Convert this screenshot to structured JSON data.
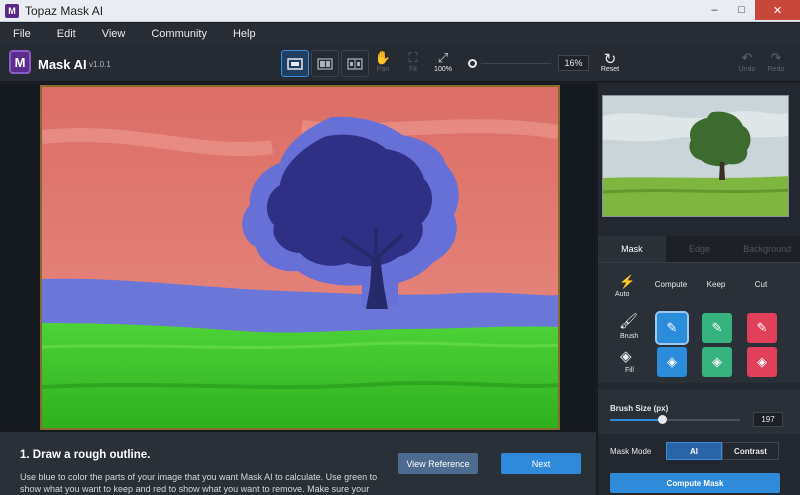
{
  "window": {
    "title": "Topaz Mask AI",
    "controls": [
      "–",
      "□",
      "✕"
    ]
  },
  "menu": [
    "File",
    "Edit",
    "View",
    "Community",
    "Help"
  ],
  "toolbar": {
    "logo_letter": "M",
    "app_name": "Mask AI",
    "version": "v1.0.1",
    "tools": {
      "pan": "Pan",
      "fit": "Fit",
      "zoom100": "100%",
      "reset": "Reset",
      "undo": "Undo",
      "redo": "Redo"
    },
    "zoom_value": "16%"
  },
  "instructions": {
    "title": "1. Draw a rough outline.",
    "text": "Use blue to color the parts of your image that you want Mask AI to calculate. Use green to show what you want to keep and red to show what you want to remove. Make sure your red/greens are accurate (feel free to apply a lot of blue)!",
    "view_reference": "View Reference",
    "next": "Next"
  },
  "panel": {
    "tabs": [
      "Mask",
      "Edge",
      "Background"
    ],
    "modes": {
      "auto": "Auto",
      "compute": "Compute",
      "keep": "Keep",
      "cut": "Cut"
    },
    "brush_label": "Brush",
    "fill_label": "Fill",
    "brush_size": {
      "label": "Brush Size (px)",
      "value": "197",
      "fraction": 0.4
    },
    "mask_mode": {
      "label": "Mask Mode",
      "ai": "AI",
      "contrast": "Contrast"
    },
    "compute_mask": "Compute Mask"
  },
  "colors": {
    "compute": "#2b8cdb",
    "keep": "#35b27d",
    "cut": "#e0405a",
    "accent": "#2f8bd9"
  }
}
